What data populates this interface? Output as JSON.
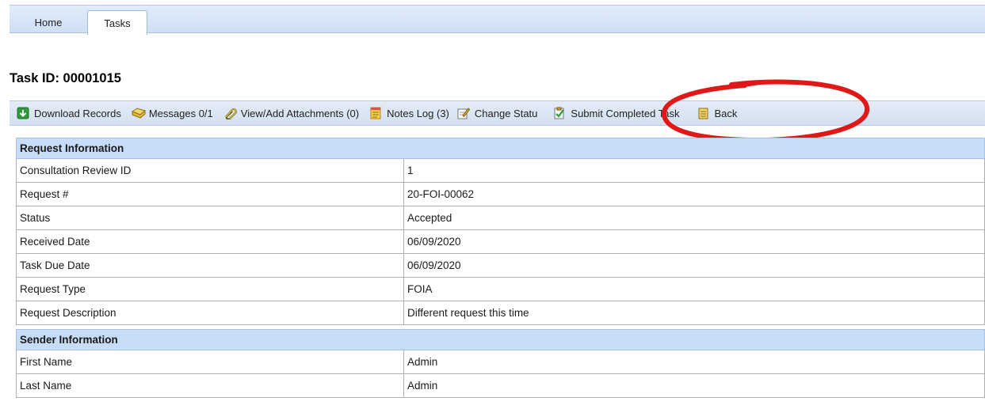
{
  "tabs": [
    {
      "label": "Home"
    },
    {
      "label": "Tasks"
    }
  ],
  "page": {
    "title": "Task ID: 00001015"
  },
  "toolbar": {
    "download": "Download Records",
    "messages": "Messages 0/1",
    "attachments": "View/Add Attachments (0)",
    "notes": "Notes Log (3)",
    "change_status": "Change Statu",
    "submit": "Submit Completed Task",
    "back": "Back"
  },
  "icons": {
    "download": "download-icon",
    "messages": "envelope-icon",
    "attachments": "paperclip-icon",
    "notes": "notepad-icon",
    "change_status": "edit-icon",
    "submit": "checklist-icon",
    "back": "back-icon"
  },
  "colors": {
    "header_bg": "#c6dcf7",
    "toolbar_bg": "#d3e0f1",
    "annotation": "#e01818"
  },
  "request_info": {
    "heading": "Request Information",
    "rows": [
      {
        "label": "Consultation Review ID",
        "value": "1"
      },
      {
        "label": "Request #",
        "value": "20-FOI-00062"
      },
      {
        "label": "Status",
        "value": "Accepted"
      },
      {
        "label": "Received Date",
        "value": "06/09/2020"
      },
      {
        "label": "Task Due Date",
        "value": "06/09/2020"
      },
      {
        "label": "Request Type",
        "value": "FOIA"
      },
      {
        "label": "Request Description",
        "value": "Different request this time"
      }
    ]
  },
  "sender_info": {
    "heading": "Sender Information",
    "rows": [
      {
        "label": "First Name",
        "value": "Admin"
      },
      {
        "label": "Last Name",
        "value": "Admin"
      }
    ]
  }
}
